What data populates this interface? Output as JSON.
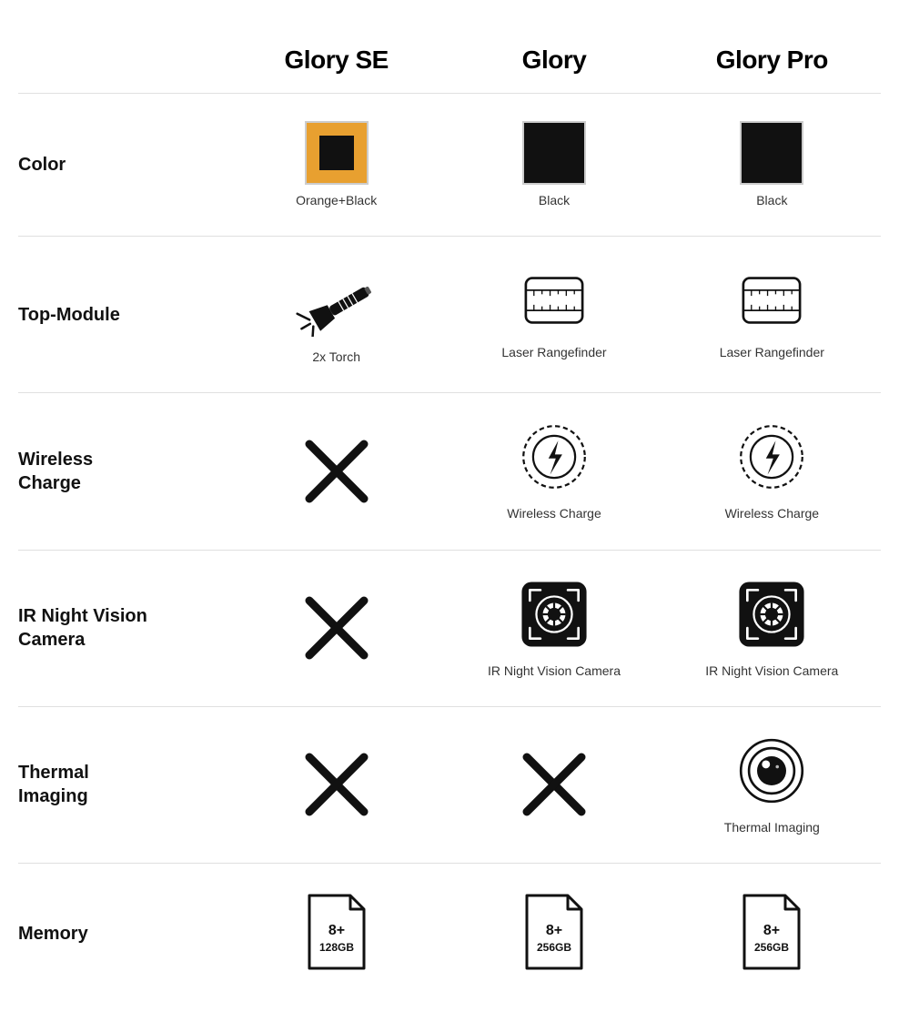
{
  "header": {
    "col1": "",
    "col2": "Glory SE",
    "col3": "Glory",
    "col4": "Glory Pro"
  },
  "rows": [
    {
      "label": "Color",
      "se": {
        "type": "color_orange_black",
        "caption": "Orange+Black"
      },
      "glory": {
        "type": "color_black",
        "caption": "Black"
      },
      "pro": {
        "type": "color_black",
        "caption": "Black"
      }
    },
    {
      "label": "Top-Module",
      "se": {
        "type": "torch",
        "caption": "2x Torch"
      },
      "glory": {
        "type": "rangefinder",
        "caption": "Laser Rangefinder"
      },
      "pro": {
        "type": "rangefinder",
        "caption": "Laser Rangefinder"
      }
    },
    {
      "label": "Wireless\nCharge",
      "se": {
        "type": "x",
        "caption": ""
      },
      "glory": {
        "type": "wireless",
        "caption": "Wireless Charge"
      },
      "pro": {
        "type": "wireless",
        "caption": "Wireless Charge"
      }
    },
    {
      "label": "IR Night Vision\nCamera",
      "se": {
        "type": "x",
        "caption": ""
      },
      "glory": {
        "type": "ir_camera",
        "caption": "IR Night Vision Camera"
      },
      "pro": {
        "type": "ir_camera",
        "caption": "IR Night Vision Camera"
      }
    },
    {
      "label": "Thermal\nImaging",
      "se": {
        "type": "x",
        "caption": ""
      },
      "glory": {
        "type": "x",
        "caption": ""
      },
      "pro": {
        "type": "thermal",
        "caption": "Thermal Imaging"
      }
    },
    {
      "label": "Memory",
      "se": {
        "type": "memory",
        "ram": "8+",
        "storage": "128GB",
        "caption": ""
      },
      "glory": {
        "type": "memory",
        "ram": "8+",
        "storage": "256GB",
        "caption": ""
      },
      "pro": {
        "type": "memory",
        "ram": "8+",
        "storage": "256GB",
        "caption": ""
      }
    }
  ]
}
